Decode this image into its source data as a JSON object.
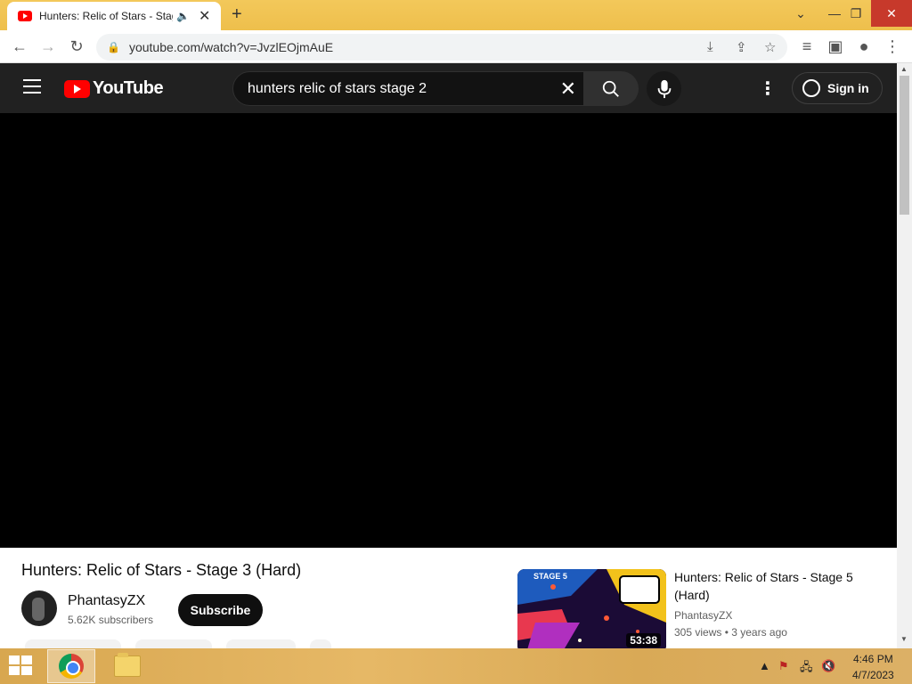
{
  "browser": {
    "tab_title": "Hunters: Relic of Stars - Stag",
    "new_tab": "+",
    "url": "youtube.com/watch?v=JvzlEOjmAuE"
  },
  "youtube": {
    "logo_text": "YouTube",
    "search_value": "hunters relic of stars stage 2",
    "sign_in": "Sign in"
  },
  "video": {
    "title": "Hunters: Relic of Stars - Stage 3 (Hard)",
    "channel": "PhantasyZX",
    "subscribers": "5.62K subscribers",
    "subscribe_label": "Subscribe"
  },
  "recommended": [
    {
      "title": "Hunters: Relic of Stars - Stage 5 (Hard)",
      "channel": "PhantasyZX",
      "views": "305 views",
      "age": "3 years ago",
      "meta": "305 views  • 3 years ago",
      "duration": "53:38",
      "thumb_label": "STAGE 5"
    }
  ],
  "taskbar": {
    "time": "4:46 PM",
    "date": "4/7/2023"
  },
  "colors": {
    "yt_red": "#ff0000",
    "yt_header": "#212121",
    "taskbar": "#dcae5e",
    "titlebar": "#f0c14b"
  }
}
